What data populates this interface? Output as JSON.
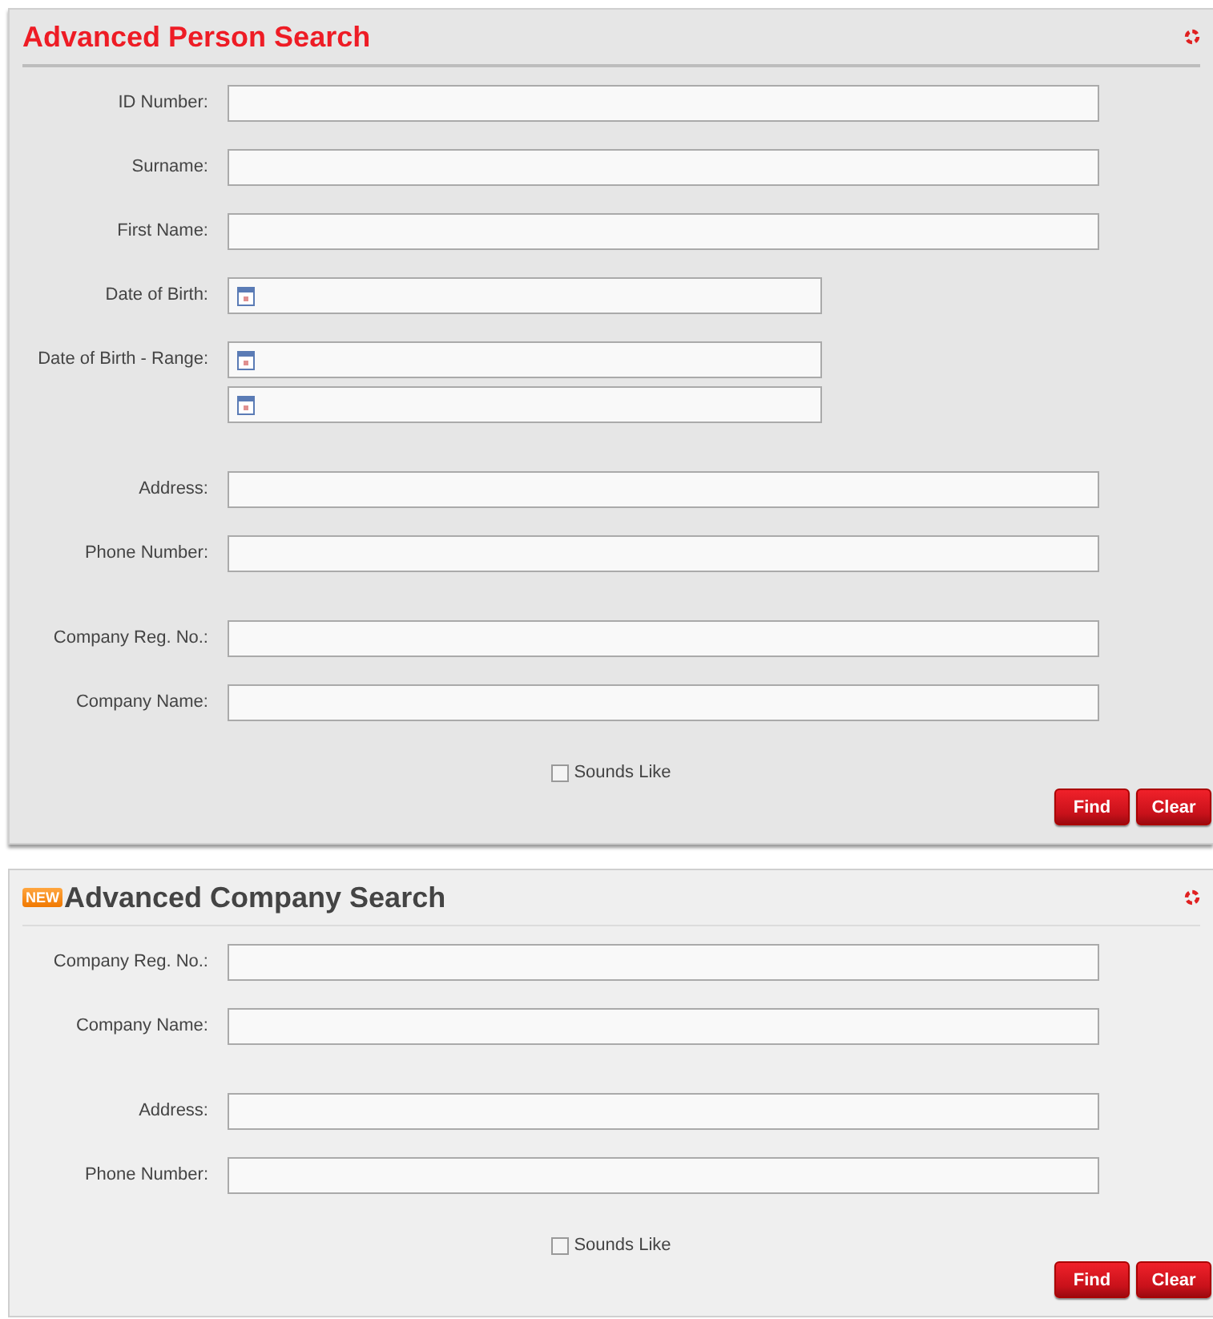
{
  "panels": [
    {
      "title": "Advanced Person Search",
      "color": "#ee1c25",
      "groups": [
        {
          "rows": [
            {
              "label": "ID Number:",
              "kind": "text"
            },
            {
              "label": "Surname:",
              "kind": "text"
            },
            {
              "label": "First Name:",
              "kind": "text"
            },
            {
              "label": "Date of Birth:",
              "kind": "date"
            },
            {
              "label": "Date of Birth - Range:",
              "kind": "date_range"
            }
          ]
        },
        {
          "rows": [
            {
              "label": "Address:",
              "kind": "text"
            },
            {
              "label": "Phone Number:",
              "kind": "text"
            }
          ]
        },
        {
          "rows": [
            {
              "label": "Company Reg. No.:",
              "kind": "text"
            },
            {
              "label": "Company Name:",
              "kind": "text"
            }
          ]
        }
      ],
      "sounds_like": {
        "label": "Sounds Like",
        "checked": false
      },
      "buttons": [
        "Find",
        "Clear"
      ]
    },
    {
      "title": "Advanced Company Search",
      "color": "#444444",
      "badge": "NEW",
      "groups": [
        {
          "rows": [
            {
              "label": "Company Reg. No.:",
              "kind": "text"
            },
            {
              "label": "Company Name:",
              "kind": "text"
            }
          ]
        },
        {
          "rows": [
            {
              "label": "Address:",
              "kind": "text"
            },
            {
              "label": "Phone Number:",
              "kind": "text"
            }
          ]
        }
      ],
      "sounds_like": {
        "label": "Sounds Like",
        "checked": false
      },
      "buttons": [
        "Find",
        "Clear"
      ]
    }
  ]
}
